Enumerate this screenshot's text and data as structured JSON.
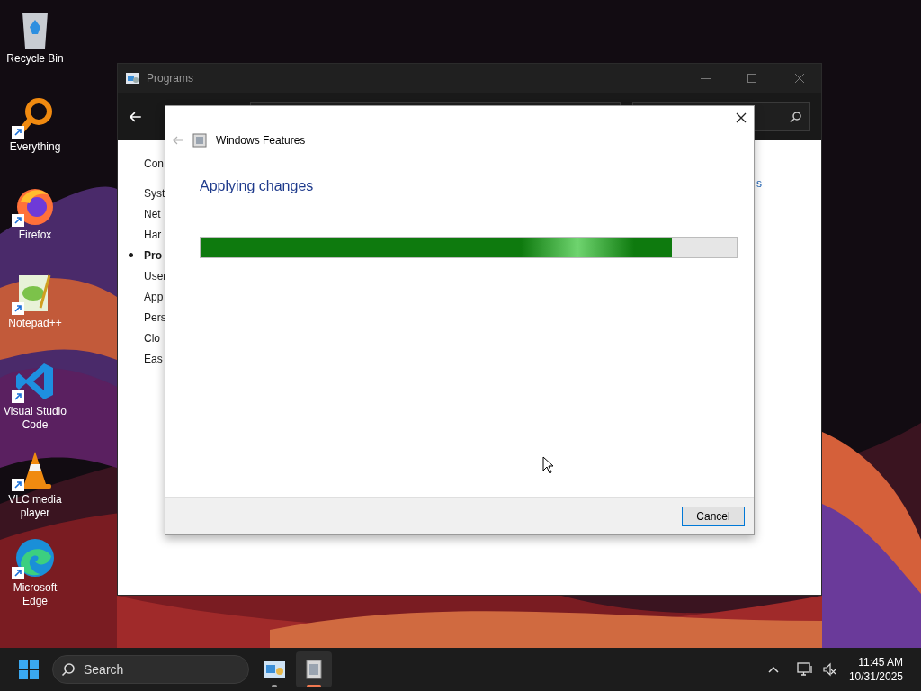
{
  "desktop_icons": [
    {
      "label": "Recycle Bin",
      "kind": "bin",
      "shortcut": false
    },
    {
      "label": "Everything",
      "kind": "search",
      "shortcut": true
    },
    {
      "label": "Firefox",
      "kind": "firefox",
      "shortcut": true
    },
    {
      "label": "Notepad++",
      "kind": "notepad",
      "shortcut": true
    },
    {
      "label": "Visual Studio Code",
      "kind": "vscode",
      "shortcut": true
    },
    {
      "label": "VLC media player",
      "kind": "vlc",
      "shortcut": true
    },
    {
      "label": "Microsoft Edge",
      "kind": "edge",
      "shortcut": true
    }
  ],
  "background_window": {
    "title": "Programs",
    "sidebar": [
      {
        "label": "Con",
        "selected": false
      },
      {
        "label": "Syst",
        "selected": false
      },
      {
        "label": "Net",
        "selected": false
      },
      {
        "label": "Har",
        "selected": false
      },
      {
        "label": "Pro",
        "selected": true
      },
      {
        "label": "User",
        "selected": false
      },
      {
        "label": "App",
        "selected": false
      },
      {
        "label": "Pers",
        "selected": false
      },
      {
        "label": "Clo",
        "selected": false
      },
      {
        "label": "Eas",
        "selected": false
      }
    ],
    "link_fragment": "s"
  },
  "dialog": {
    "title": "Windows Features",
    "heading": "Applying changes",
    "progress": {
      "level": 0.88
    },
    "buttons": [
      "Cancel"
    ]
  },
  "taskbar": {
    "search": {
      "placeholder": "Search"
    },
    "apps": [
      {
        "kind": "control-panel",
        "selected": false
      },
      {
        "kind": "features",
        "selected": true
      }
    ],
    "time": "11:45 AM",
    "date": "10/31/2025"
  }
}
